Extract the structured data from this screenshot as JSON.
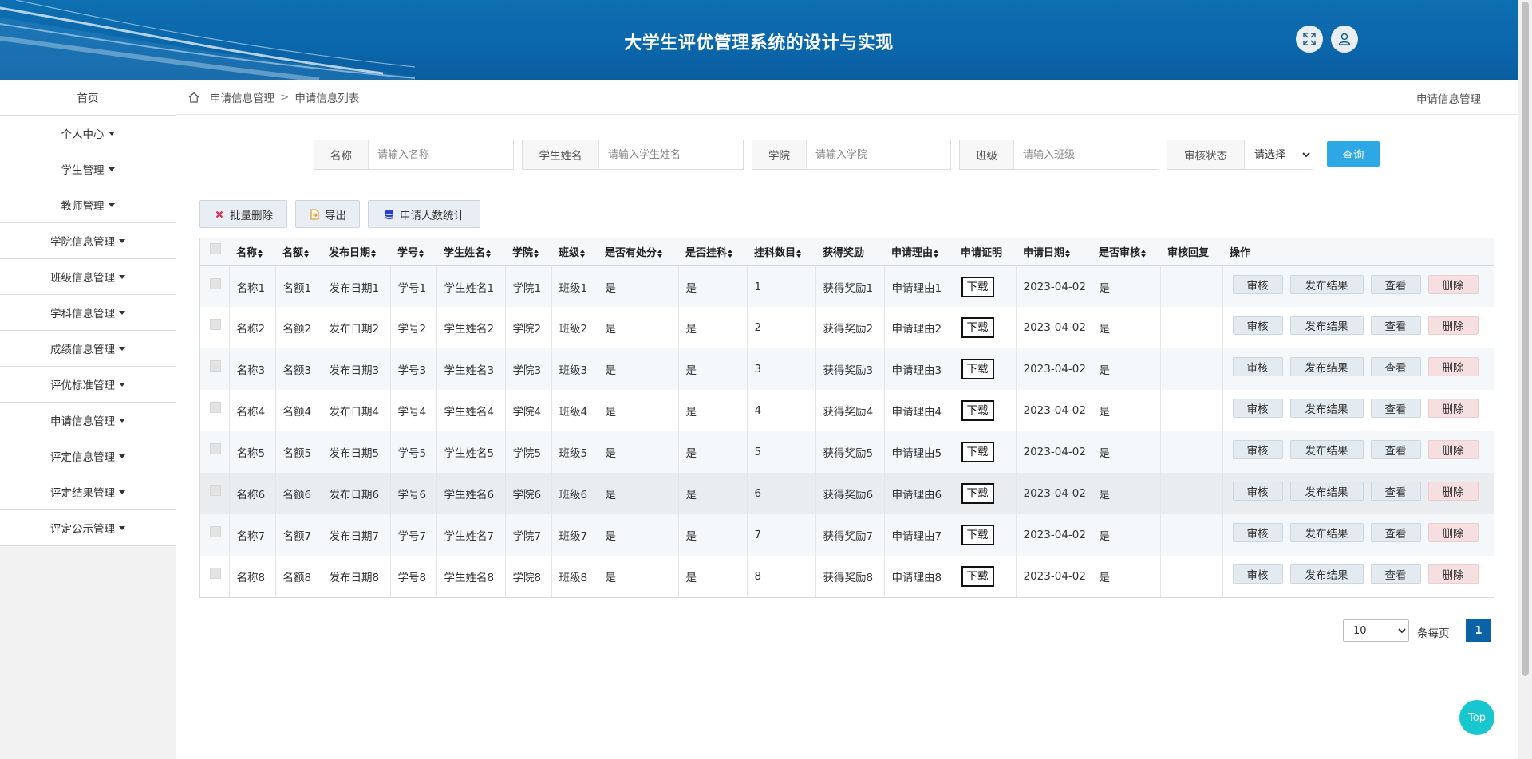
{
  "header": {
    "title": "大学生评优管理系统的设计与实现"
  },
  "sidebar": {
    "items": [
      {
        "label": "首页",
        "dropdown": false
      },
      {
        "label": "个人中心",
        "dropdown": true
      },
      {
        "label": "学生管理",
        "dropdown": true
      },
      {
        "label": "教师管理",
        "dropdown": true
      },
      {
        "label": "学院信息管理",
        "dropdown": true
      },
      {
        "label": "班级信息管理",
        "dropdown": true
      },
      {
        "label": "学科信息管理",
        "dropdown": true
      },
      {
        "label": "成绩信息管理",
        "dropdown": true
      },
      {
        "label": "评优标准管理",
        "dropdown": true
      },
      {
        "label": "申请信息管理",
        "dropdown": true
      },
      {
        "label": "评定信息管理",
        "dropdown": true
      },
      {
        "label": "评定结果管理",
        "dropdown": true
      },
      {
        "label": "评定公示管理",
        "dropdown": true
      }
    ]
  },
  "breadcrumb": {
    "level1": "申请信息管理",
    "sep": ">",
    "level2": "申请信息列表",
    "right": "申请信息管理"
  },
  "search": {
    "fields": [
      {
        "label": "名称",
        "placeholder": "请输入名称"
      },
      {
        "label": "学生姓名",
        "placeholder": "请输入学生姓名"
      },
      {
        "label": "学院",
        "placeholder": "请输入学院"
      },
      {
        "label": "班级",
        "placeholder": "请输入班级"
      }
    ],
    "status_label": "审核状态",
    "status_value": "请选择",
    "query_label": "查询"
  },
  "actions": {
    "batch_delete": "批量删除",
    "export": "导出",
    "stats": "申请人数统计"
  },
  "table": {
    "headers": [
      "名称",
      "名额",
      "发布日期",
      "学号",
      "学生姓名",
      "学院",
      "班级",
      "是否有处分",
      "是否挂科",
      "挂科数目",
      "获得奖励",
      "申请理由",
      "申请证明",
      "申请日期",
      "是否审核",
      "审核回复",
      "操作"
    ],
    "download_label": "下载",
    "op_labels": {
      "review": "审核",
      "publish": "发布结果",
      "view": "查看",
      "delete": "删除"
    },
    "rows": [
      [
        "名称1",
        "名额1",
        "发布日期1",
        "学号1",
        "学生姓名1",
        "学院1",
        "班级1",
        "是",
        "是",
        "1",
        "获得奖励1",
        "申请理由1",
        "2023-04-02",
        "是",
        ""
      ],
      [
        "名称2",
        "名额2",
        "发布日期2",
        "学号2",
        "学生姓名2",
        "学院2",
        "班级2",
        "是",
        "是",
        "2",
        "获得奖励2",
        "申请理由2",
        "2023-04-02",
        "是",
        ""
      ],
      [
        "名称3",
        "名额3",
        "发布日期3",
        "学号3",
        "学生姓名3",
        "学院3",
        "班级3",
        "是",
        "是",
        "3",
        "获得奖励3",
        "申请理由3",
        "2023-04-02",
        "是",
        ""
      ],
      [
        "名称4",
        "名额4",
        "发布日期4",
        "学号4",
        "学生姓名4",
        "学院4",
        "班级4",
        "是",
        "是",
        "4",
        "获得奖励4",
        "申请理由4",
        "2023-04-02",
        "是",
        ""
      ],
      [
        "名称5",
        "名额5",
        "发布日期5",
        "学号5",
        "学生姓名5",
        "学院5",
        "班级5",
        "是",
        "是",
        "5",
        "获得奖励5",
        "申请理由5",
        "2023-04-02",
        "是",
        ""
      ],
      [
        "名称6",
        "名额6",
        "发布日期6",
        "学号6",
        "学生姓名6",
        "学院6",
        "班级6",
        "是",
        "是",
        "6",
        "获得奖励6",
        "申请理由6",
        "2023-04-02",
        "是",
        ""
      ],
      [
        "名称7",
        "名额7",
        "发布日期7",
        "学号7",
        "学生姓名7",
        "学院7",
        "班级7",
        "是",
        "是",
        "7",
        "获得奖励7",
        "申请理由7",
        "2023-04-02",
        "是",
        ""
      ],
      [
        "名称8",
        "名额8",
        "发布日期8",
        "学号8",
        "学生姓名8",
        "学院8",
        "班级8",
        "是",
        "是",
        "8",
        "获得奖励8",
        "申请理由8",
        "2023-04-02",
        "是",
        ""
      ]
    ]
  },
  "pagination": {
    "page_size": "10",
    "per_page_label": "条每页",
    "current_page": "1"
  },
  "back_to_top": "Top",
  "colors": {
    "header": "#0a66aa",
    "primary": "#2ea8e5",
    "page_active": "#0b63a5",
    "top_button": "#18c6cf"
  }
}
